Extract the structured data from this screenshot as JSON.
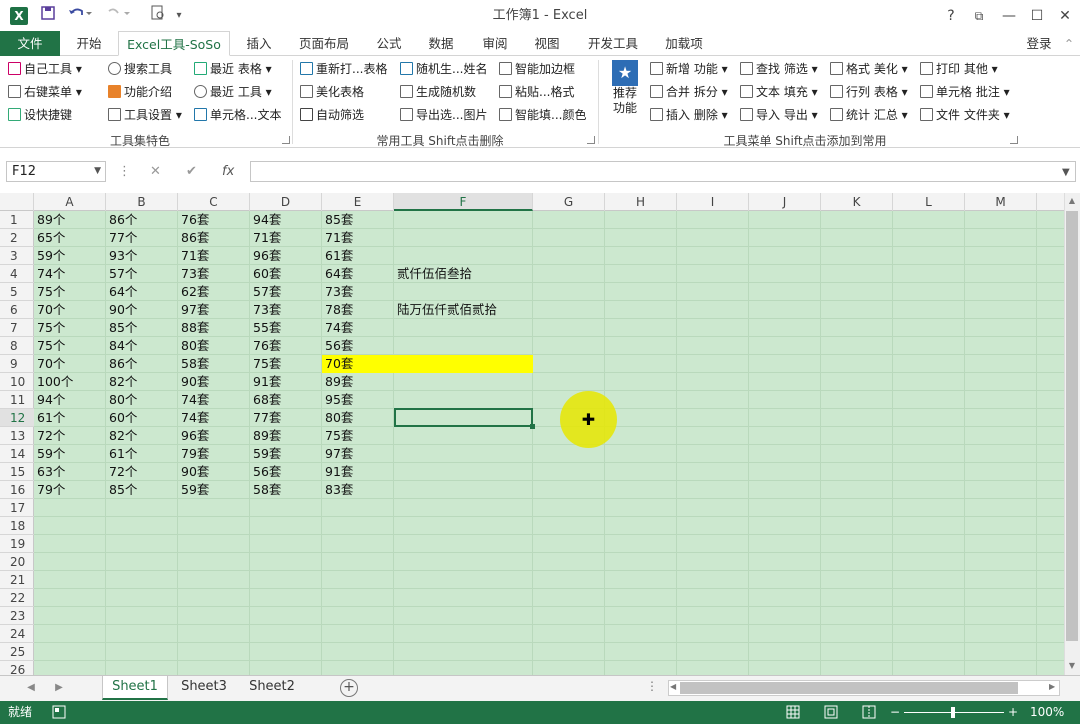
{
  "titlebar": {
    "logo": "X",
    "title": "工作簿1 - Excel",
    "help": "?",
    "restore": "⧉",
    "minimize": "—",
    "maximize": "☐",
    "close": "✕"
  },
  "tabs": [
    "文件",
    "开始",
    "Excel工具-SoSo",
    "插入",
    "页面布局",
    "公式",
    "数据",
    "审阅",
    "视图",
    "开发工具",
    "加载项"
  ],
  "login": "登录",
  "ribbon": {
    "group1": {
      "items": [
        "自己工具",
        "右键菜单",
        "设快捷键",
        "搜索工具",
        "功能介绍",
        "工具设置",
        "最近   表格",
        "最近   工具",
        "单元格...文本"
      ],
      "label": "工具集特色"
    },
    "group2": {
      "items": [
        "重新打...表格",
        "美化表格",
        "自动筛选",
        "随机生...姓名",
        "生成随机数",
        "导出选...图片",
        "智能加边框",
        "粘贴...格式",
        "智能填...颜色"
      ],
      "label": "常用工具 Shift点击删除"
    },
    "group3": {
      "recommend": "推荐\n功能",
      "items": [
        "新增 功能",
        "合并 拆分",
        "插入 删除",
        "查找 筛选",
        "文本 填充",
        "导入 导出",
        "格式 美化",
        "行列 表格",
        "统计 汇总",
        "打印 其他",
        "单元格 批注",
        "文件 文件夹"
      ],
      "label": "工具菜单 Shift点击添加到常用"
    }
  },
  "formula_bar": {
    "name_box": "F12",
    "cancel": "✕",
    "enter": "✔",
    "fx": "fx",
    "value": ""
  },
  "columns": [
    "A",
    "B",
    "C",
    "D",
    "E",
    "F",
    "G",
    "H",
    "I",
    "J",
    "K",
    "L",
    "M"
  ],
  "rows": [
    "1",
    "2",
    "3",
    "4",
    "5",
    "6",
    "7",
    "8",
    "9",
    "10",
    "11",
    "12",
    "13",
    "14",
    "15",
    "16",
    "17",
    "18",
    "19",
    "20",
    "21",
    "22",
    "23",
    "24",
    "25",
    "26"
  ],
  "cells": [
    [
      "89个",
      "86个",
      "76套",
      "94套",
      "85套"
    ],
    [
      "65个",
      "77个",
      "86套",
      "71套",
      "71套"
    ],
    [
      "59个",
      "93个",
      "71套",
      "96套",
      "61套"
    ],
    [
      "74个",
      "57个",
      "73套",
      "60套",
      "64套"
    ],
    [
      "75个",
      "64个",
      "62套",
      "57套",
      "73套"
    ],
    [
      "70个",
      "90个",
      "97套",
      "73套",
      "78套"
    ],
    [
      "75个",
      "85个",
      "88套",
      "55套",
      "74套"
    ],
    [
      "75个",
      "84个",
      "80套",
      "76套",
      "56套"
    ],
    [
      "70个",
      "86个",
      "58套",
      "75套",
      "70套"
    ],
    [
      "100个",
      "82个",
      "90套",
      "91套",
      "89套"
    ],
    [
      "94个",
      "80个",
      "74套",
      "68套",
      "95套"
    ],
    [
      "61个",
      "60个",
      "74套",
      "77套",
      "80套"
    ],
    [
      "72个",
      "82个",
      "96套",
      "89套",
      "75套"
    ],
    [
      "59个",
      "61个",
      "79套",
      "59套",
      "97套"
    ],
    [
      "63个",
      "72个",
      "90套",
      "56套",
      "91套"
    ],
    [
      "79个",
      "85个",
      "59套",
      "58套",
      "83套"
    ]
  ],
  "f_cells": {
    "F4": "贰仟伍佰叁拾",
    "F6": "陆万伍仟贰佰贰拾"
  },
  "highlight_color": "#ffff00",
  "sheet_tabs": [
    "Sheet1",
    "Sheet3",
    "Sheet2"
  ],
  "status": {
    "ready": "就绪",
    "zoom": "100%"
  },
  "colors": {
    "accent": "#217346",
    "grid_bg": "#cce8cf"
  }
}
